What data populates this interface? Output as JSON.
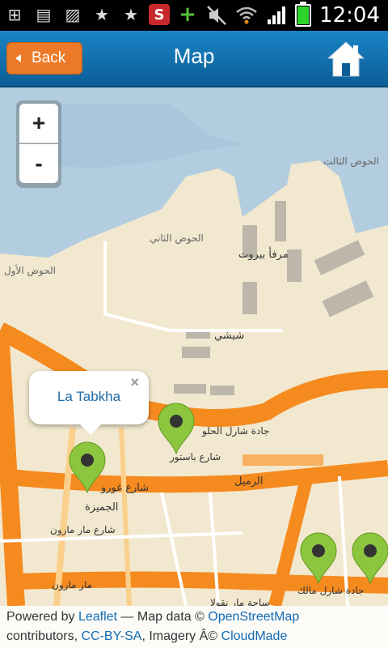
{
  "status": {
    "time": "12:04",
    "notification_icons": [
      "add-box-icon",
      "sd-card-icon",
      "image-icon",
      "star-icon",
      "star-icon",
      "s-app-icon",
      "plus-icon"
    ],
    "s_app_letter": "S"
  },
  "appbar": {
    "back_label": "Back",
    "title": "Map",
    "colors": {
      "bar": "#0f6fb0",
      "back_button": "#ed7a28"
    }
  },
  "map": {
    "zoom_in_label": "+",
    "zoom_out_label": "-",
    "popup": {
      "title": "La Tabkha",
      "close": "×"
    },
    "markers": [
      {
        "name": "marker-la-tabkha"
      },
      {
        "name": "marker-2"
      },
      {
        "name": "marker-3"
      },
      {
        "name": "marker-4"
      }
    ],
    "labels": [
      "الحوض الثالث",
      "الحوض الثاني",
      "الحوض الأول",
      "مرفأ بيروت",
      "شيشي",
      "شارع غورو",
      "الجميزة",
      "شارع مار مارون",
      "مار مارون",
      "جادة شارل الحلو",
      "الرميل",
      "جادة شارل مالك",
      "ساحة مار نقولا",
      "شارع باستور"
    ]
  },
  "attribution": {
    "powered_by": "Powered by ",
    "leaflet": "Leaflet",
    "map_data": " — Map data © ",
    "osm": "OpenStreetMap",
    "contributors": "contributors, ",
    "ccbysa": "CC-BY-SA",
    "imagery": ", Imagery Â© ",
    "cloudmade": "CloudMade"
  }
}
